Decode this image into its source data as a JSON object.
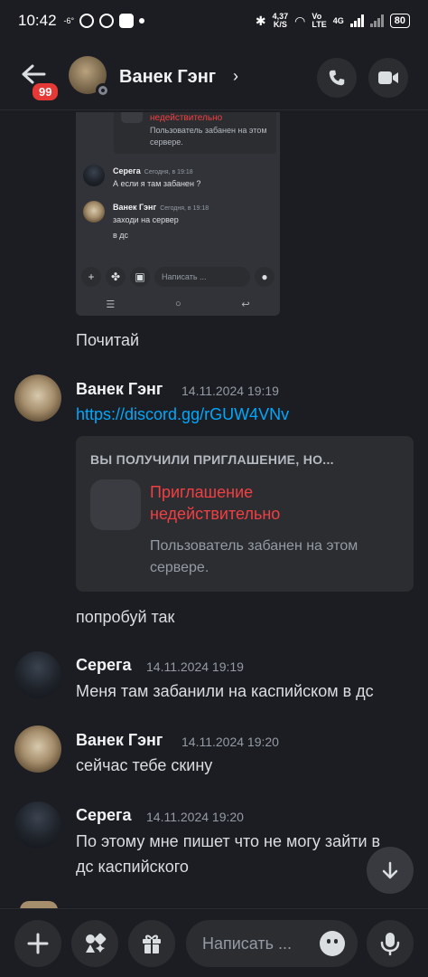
{
  "status_bar": {
    "time": "10:42",
    "temp": "-6°",
    "net_speed": "4,37\nK/S",
    "volte": "Vo\nLTE",
    "net_type": "4G",
    "battery": "80"
  },
  "header": {
    "back_badge": "99",
    "title": "Ванек Гэнг"
  },
  "screenshot": {
    "invite_title": "недействительно",
    "invite_desc": "Пользователь забанен на этом сервере.",
    "msg1_user": "Серега",
    "msg1_time": "Сегодня, в 19:18",
    "msg1_text": "А если я там забанен ?",
    "msg2_user": "Ванек Гэнг",
    "msg2_time": "Сегодня, в 19:18",
    "msg2_line1": "заходи на сервер",
    "msg2_line2": "в дс",
    "composer_placeholder": "Написать ..."
  },
  "messages": {
    "m0_text": "Почитай",
    "m1_user": "Ванек Гэнг",
    "m1_time": "14.11.2024 19:19",
    "m1_link": "https://discord.gg/rGUW4VNv",
    "invite_header": "ВЫ ПОЛУЧИЛИ ПРИГЛАШЕНИЕ, НО...",
    "invite_title": "Приглашение недействительно",
    "invite_desc": "Пользователь забанен на этом сервере.",
    "m1_followup": "попробуй так",
    "m2_user": "Серега",
    "m2_time": "14.11.2024 19:19",
    "m2_text": "Меня там забанили на каспийском в дс",
    "m3_user": "Ванек Гэнг",
    "m3_time": "14.11.2024 19:20",
    "m3_text": "сейчас тебе скину",
    "m4_user": "Серега",
    "m4_time": "14.11.2024 19:20",
    "m4_line1": "По этому мне пишет что не могу зайти в",
    "m4_line2": "дс каспийского"
  },
  "composer": {
    "placeholder": "Написать ..."
  },
  "colors": {
    "background": "#1c1d22",
    "link": "#00a8fc",
    "error": "#f23f43",
    "badge": "#e53935"
  },
  "icons": [
    "back-arrow-icon",
    "call-icon",
    "video-icon",
    "plus-icon",
    "apps-icon",
    "gift-icon",
    "emoji-icon",
    "mic-icon",
    "arrow-down-icon"
  ]
}
